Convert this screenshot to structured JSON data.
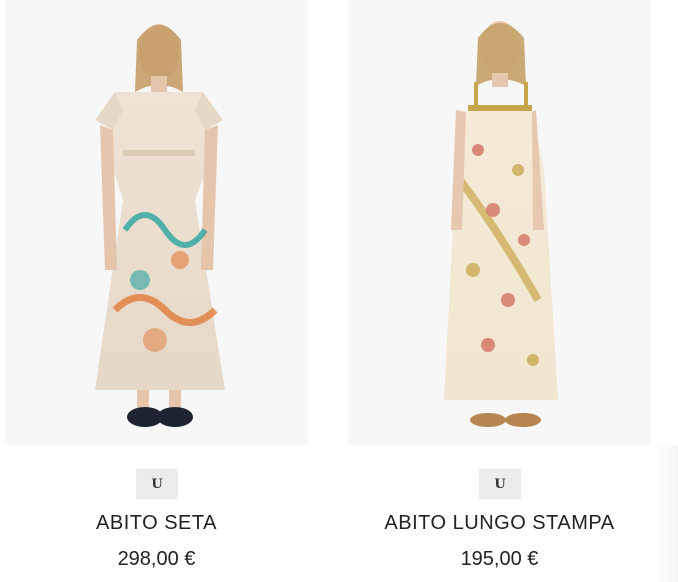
{
  "products": [
    {
      "name": "ABITO SETA",
      "price": "298,00 €",
      "badge": "U",
      "image": {
        "type": "model-photo",
        "icon": "dress-photo-icon",
        "colors": {
          "bg": "#f7f7f7",
          "dress": "#e6d8c7",
          "print1": "#2aa4a0",
          "print2": "#e07b3a",
          "skin": "#e5c6ad",
          "hair": "#c59c67",
          "shoes": "#1f2433"
        }
      }
    },
    {
      "name": "ABITO LUNGO STAMPA",
      "price": "195,00 €",
      "badge": "U",
      "image": {
        "type": "model-photo",
        "icon": "dress-photo-icon",
        "colors": {
          "bg": "#f7f7f7",
          "dress": "#f1e6cf",
          "print1": "#d06a5a",
          "print2": "#c7a54a",
          "skin": "#e6c8b0",
          "hair": "#c7a269",
          "shoes": "#b7864e"
        }
      }
    }
  ]
}
